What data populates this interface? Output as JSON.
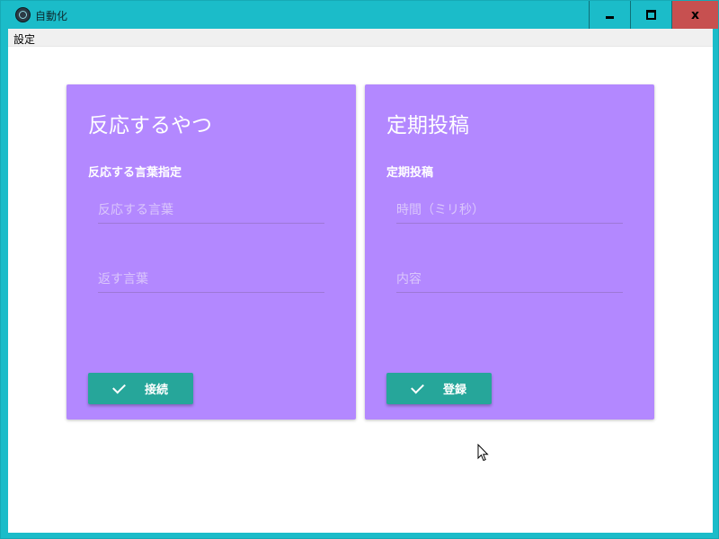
{
  "window": {
    "title": "自動化",
    "controls": {
      "close_glyph": "x"
    }
  },
  "menu": {
    "items": [
      {
        "label": "設定"
      }
    ]
  },
  "cards": [
    {
      "title": "反応するやつ",
      "subtitle": "反応する言葉指定",
      "fields": [
        {
          "placeholder": "反応する言葉",
          "value": ""
        },
        {
          "placeholder": "返す言葉",
          "value": ""
        }
      ],
      "button": {
        "label": "接続",
        "icon": "check-icon"
      }
    },
    {
      "title": "定期投稿",
      "subtitle": "定期投稿",
      "fields": [
        {
          "placeholder": "時間（ミリ秒）",
          "value": ""
        },
        {
          "placeholder": "内容",
          "value": ""
        }
      ],
      "button": {
        "label": "登録",
        "icon": "check-icon"
      }
    }
  ],
  "colors": {
    "frame": "#1bbcc9",
    "card": "#b388ff",
    "button": "#26a69a",
    "close": "#c75050"
  }
}
